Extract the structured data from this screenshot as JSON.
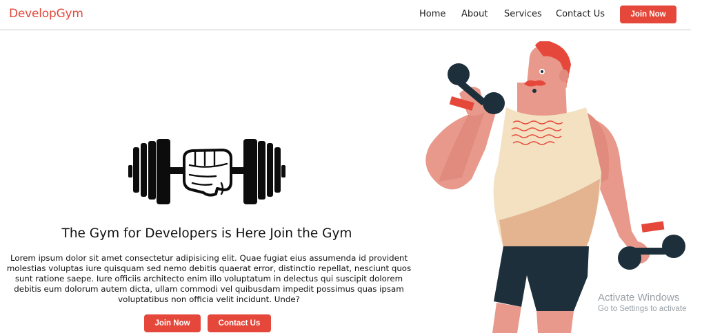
{
  "brand": "DevelopGym",
  "nav": {
    "links": [
      "Home",
      "About",
      "Services",
      "Contact Us"
    ],
    "cta": "Join Now"
  },
  "hero": {
    "headline": "The Gym for Developers is Here Join the Gym",
    "paragraph": "Lorem ipsum dolor sit amet consectetur adipisicing elit. Quae fugiat eius assumenda id provident molestias voluptas iure quisquam sed nemo debitis quaerat error, distinctio repellat, nesciunt quos sunt ratione saepe. Iure officiis architecto enim illo voluptatum in delectus qui suscipit dolorem debitis eum dolorum autem dicta, ullam commodi vel quibusdam impedit possimus quas ipsam voluptatibus non officia velit incidunt. Unde?",
    "buttons": [
      "Join Now",
      "Contact Us"
    ],
    "icon": "dumbbell-fist-icon"
  },
  "illustration": "bodybuilder-illustration",
  "watermark": {
    "title": "Activate Windows",
    "subtitle": "Go to Settings to activate"
  },
  "colors": {
    "accent": "#e5483a",
    "text": "#111111",
    "divider": "#c9c9c9"
  }
}
